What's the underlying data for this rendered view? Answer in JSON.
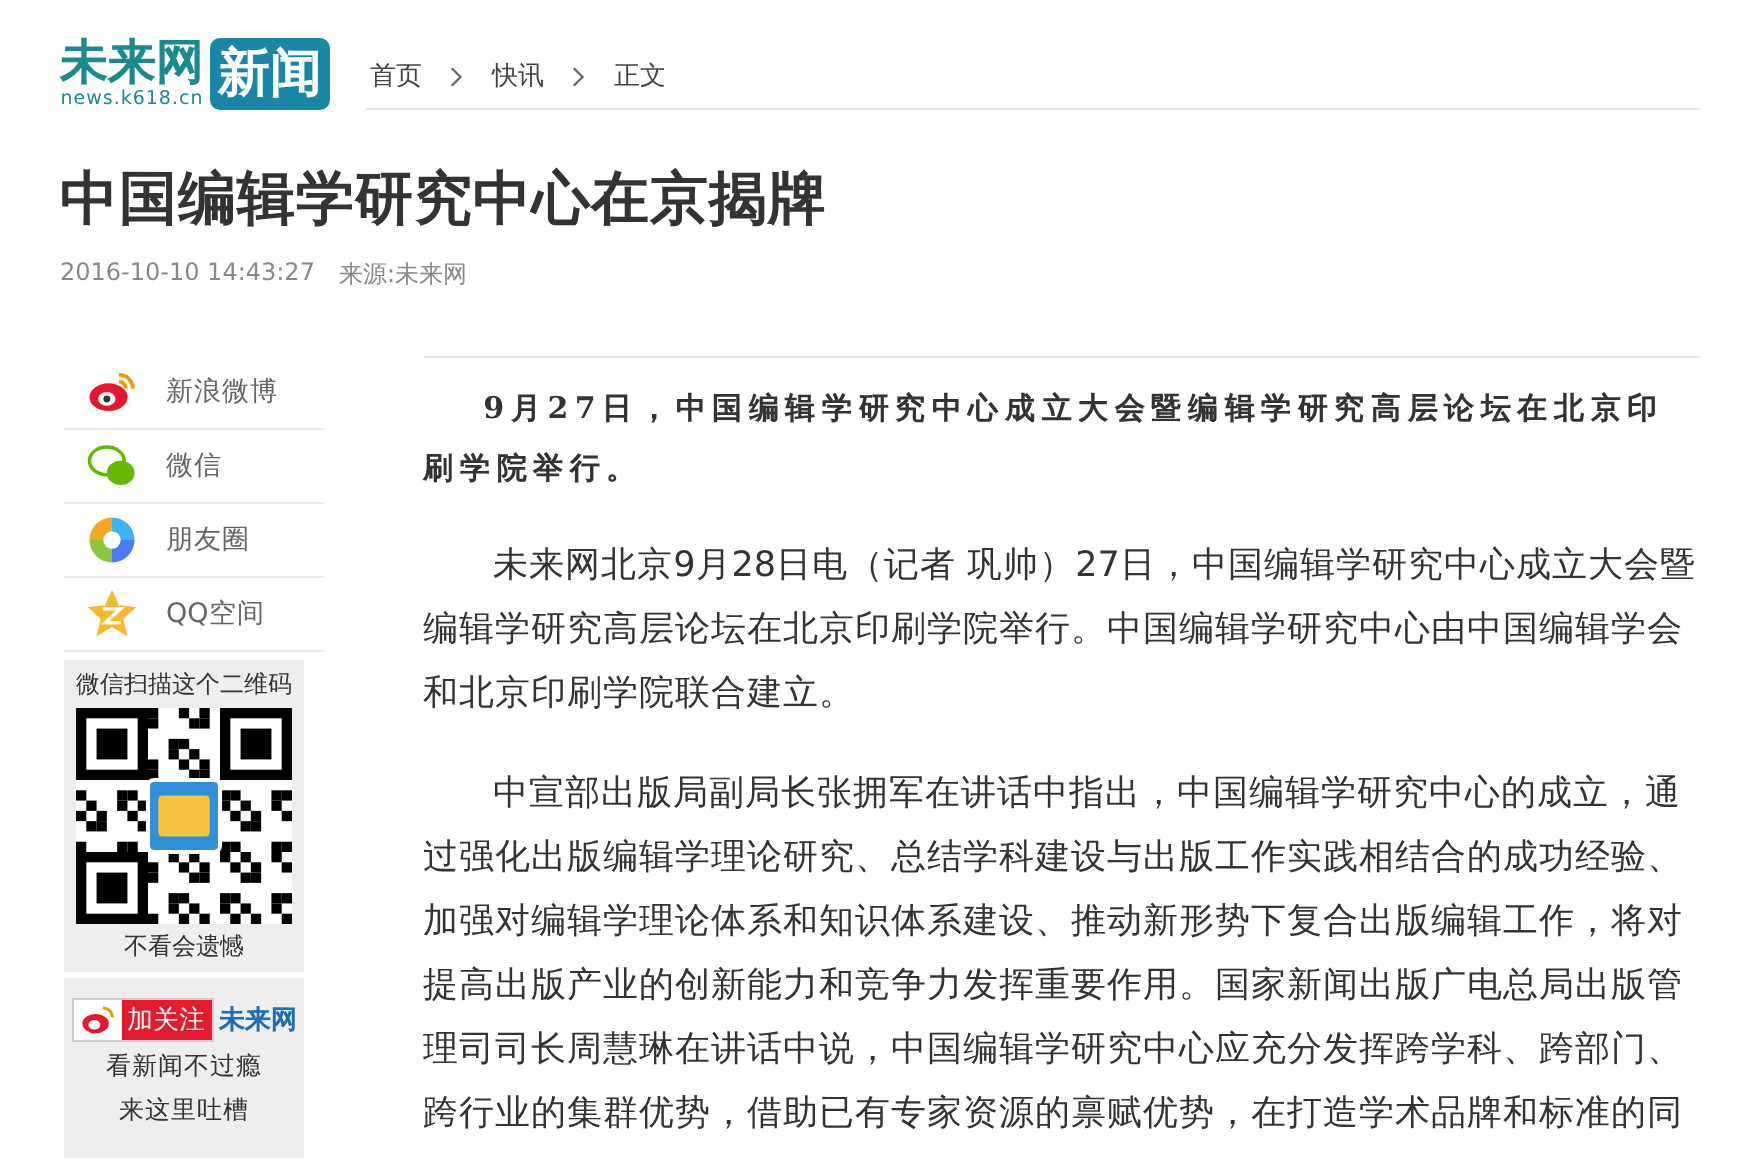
{
  "logo": {
    "name": "未来网",
    "badge": "新闻",
    "domain": "news.k618.cn"
  },
  "breadcrumb": [
    {
      "label": "首页"
    },
    {
      "label": "快讯"
    },
    {
      "label": "正文"
    }
  ],
  "article": {
    "title": "中国编辑学研究中心在京揭牌",
    "datetime": "2016-10-10 14:43:27",
    "source": "来源:未来网",
    "lead": "9月27日，中国编辑学研究中心成立大会暨编辑学研究高层论坛在北京印刷学院举行。",
    "paragraphs": [
      "未来网北京9月28日电（记者 巩帅）27日，中国编辑学研究中心成立大会暨编辑学研究高层论坛在北京印刷学院举行。中国编辑学研究中心由中国编辑学会和北京印刷学院联合建立。",
      "中宣部出版局副局长张拥军在讲话中指出，中国编辑学研究中心的成立，通过强化出版编辑学理论研究、总结学科建设与出版工作实践相结合的成功经验、加强对编辑学理论体系和知识体系建设、推动新形势下复合出版编辑工作，将对提高出版产业的创新能力和竞争力发挥重要作用。国家新闻出版广电总局出版管理司司长周慧琳在讲话中说，中国编辑学研究中心应充分发挥跨学科、跨部门、跨行业的集群优势，借助已有专家资源的禀赋优势，在打造学术品牌和标准的同"
    ]
  },
  "share": [
    {
      "kind": "weibo",
      "label": "新浪微博"
    },
    {
      "kind": "wechat",
      "label": "微信"
    },
    {
      "kind": "moments",
      "label": "朋友圈"
    },
    {
      "kind": "qzone",
      "label": "QQ空间"
    }
  ],
  "qr_box": {
    "caption_top": "微信扫描这个二维码",
    "caption_bottom": "不看会遗憾"
  },
  "weibo_box": {
    "follow_button": "加关注",
    "account": "未来网",
    "lines": [
      "看新闻不过瘾",
      "来这里吐槽"
    ]
  }
}
